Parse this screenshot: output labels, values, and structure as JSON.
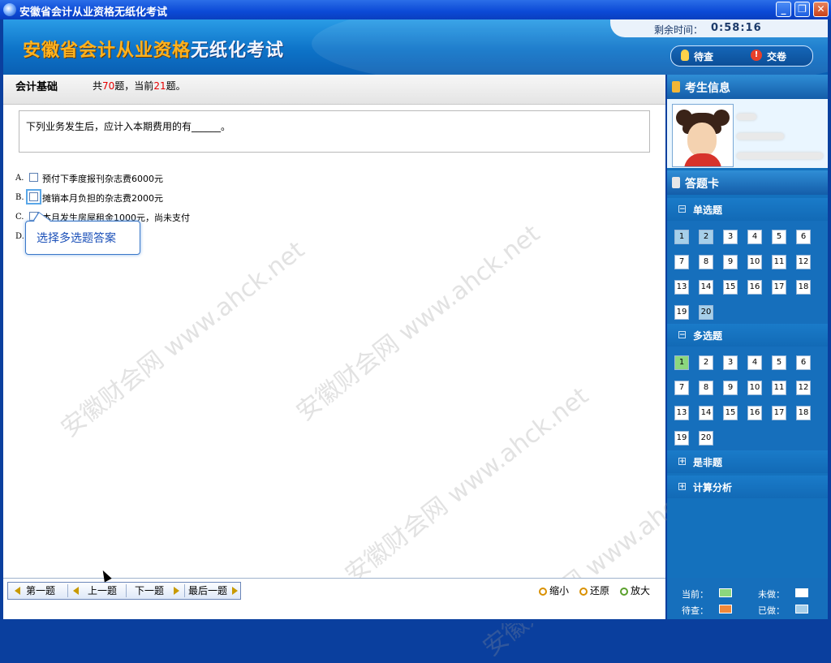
{
  "window": {
    "title": "安徽省会计从业资格无纸化考试"
  },
  "banner": {
    "logo_orange": "安徽省会计从业资格",
    "logo_white": "无纸化考试",
    "timer_label": "剩余时间：",
    "timer_value": "0:58:16",
    "pending_label": "待查",
    "submit_label": "交卷"
  },
  "question": {
    "subject": "会计基础",
    "progress_prefix": "共",
    "total": "70",
    "progress_mid": "题，当前",
    "current": "21",
    "progress_suffix": "题。",
    "stem": "下列业务发生后，应计入本期费用的有______。",
    "options": [
      {
        "letter": "A.",
        "text": "预付下季度报刊杂志费6000元"
      },
      {
        "letter": "B.",
        "text": "摊销本月负担的杂志费2000元"
      },
      {
        "letter": "C.",
        "text": "本月发生房屋租金1000元，尚未支付"
      },
      {
        "letter": "D.",
        "text": ""
      }
    ],
    "tooltip": "选择多选题答案"
  },
  "nav": {
    "first": "第一题",
    "prev": "上一题",
    "next": "下一题",
    "last": "最后一题",
    "zoom_out": "缩小",
    "reset": "还原",
    "zoom_in": "放大"
  },
  "sidebar": {
    "examinee_title": "考生信息",
    "card_title": "答题卡",
    "sections": {
      "single": "单选题",
      "multi": "多选题",
      "judge": "是非题",
      "calc": "计算分析"
    },
    "single_numbers": [
      "1",
      "2",
      "3",
      "4",
      "5",
      "6",
      "7",
      "8",
      "9",
      "10",
      "11",
      "12",
      "13",
      "14",
      "15",
      "16",
      "17",
      "18",
      "19",
      "20"
    ],
    "multi_numbers": [
      "1",
      "2",
      "3",
      "4",
      "5",
      "6",
      "7",
      "8",
      "9",
      "10",
      "11",
      "12",
      "13",
      "14",
      "15",
      "16",
      "17",
      "18",
      "19",
      "20"
    ],
    "legend": {
      "current": "当前：",
      "undone": "未做：",
      "pending": "待查：",
      "done": "已做："
    },
    "colors": {
      "current": "#8bd77e",
      "undone": "#ffffff",
      "pending": "#f0883a",
      "done": "#a6cfe9"
    }
  },
  "watermark": "安徽财会网 www.ahck.net"
}
